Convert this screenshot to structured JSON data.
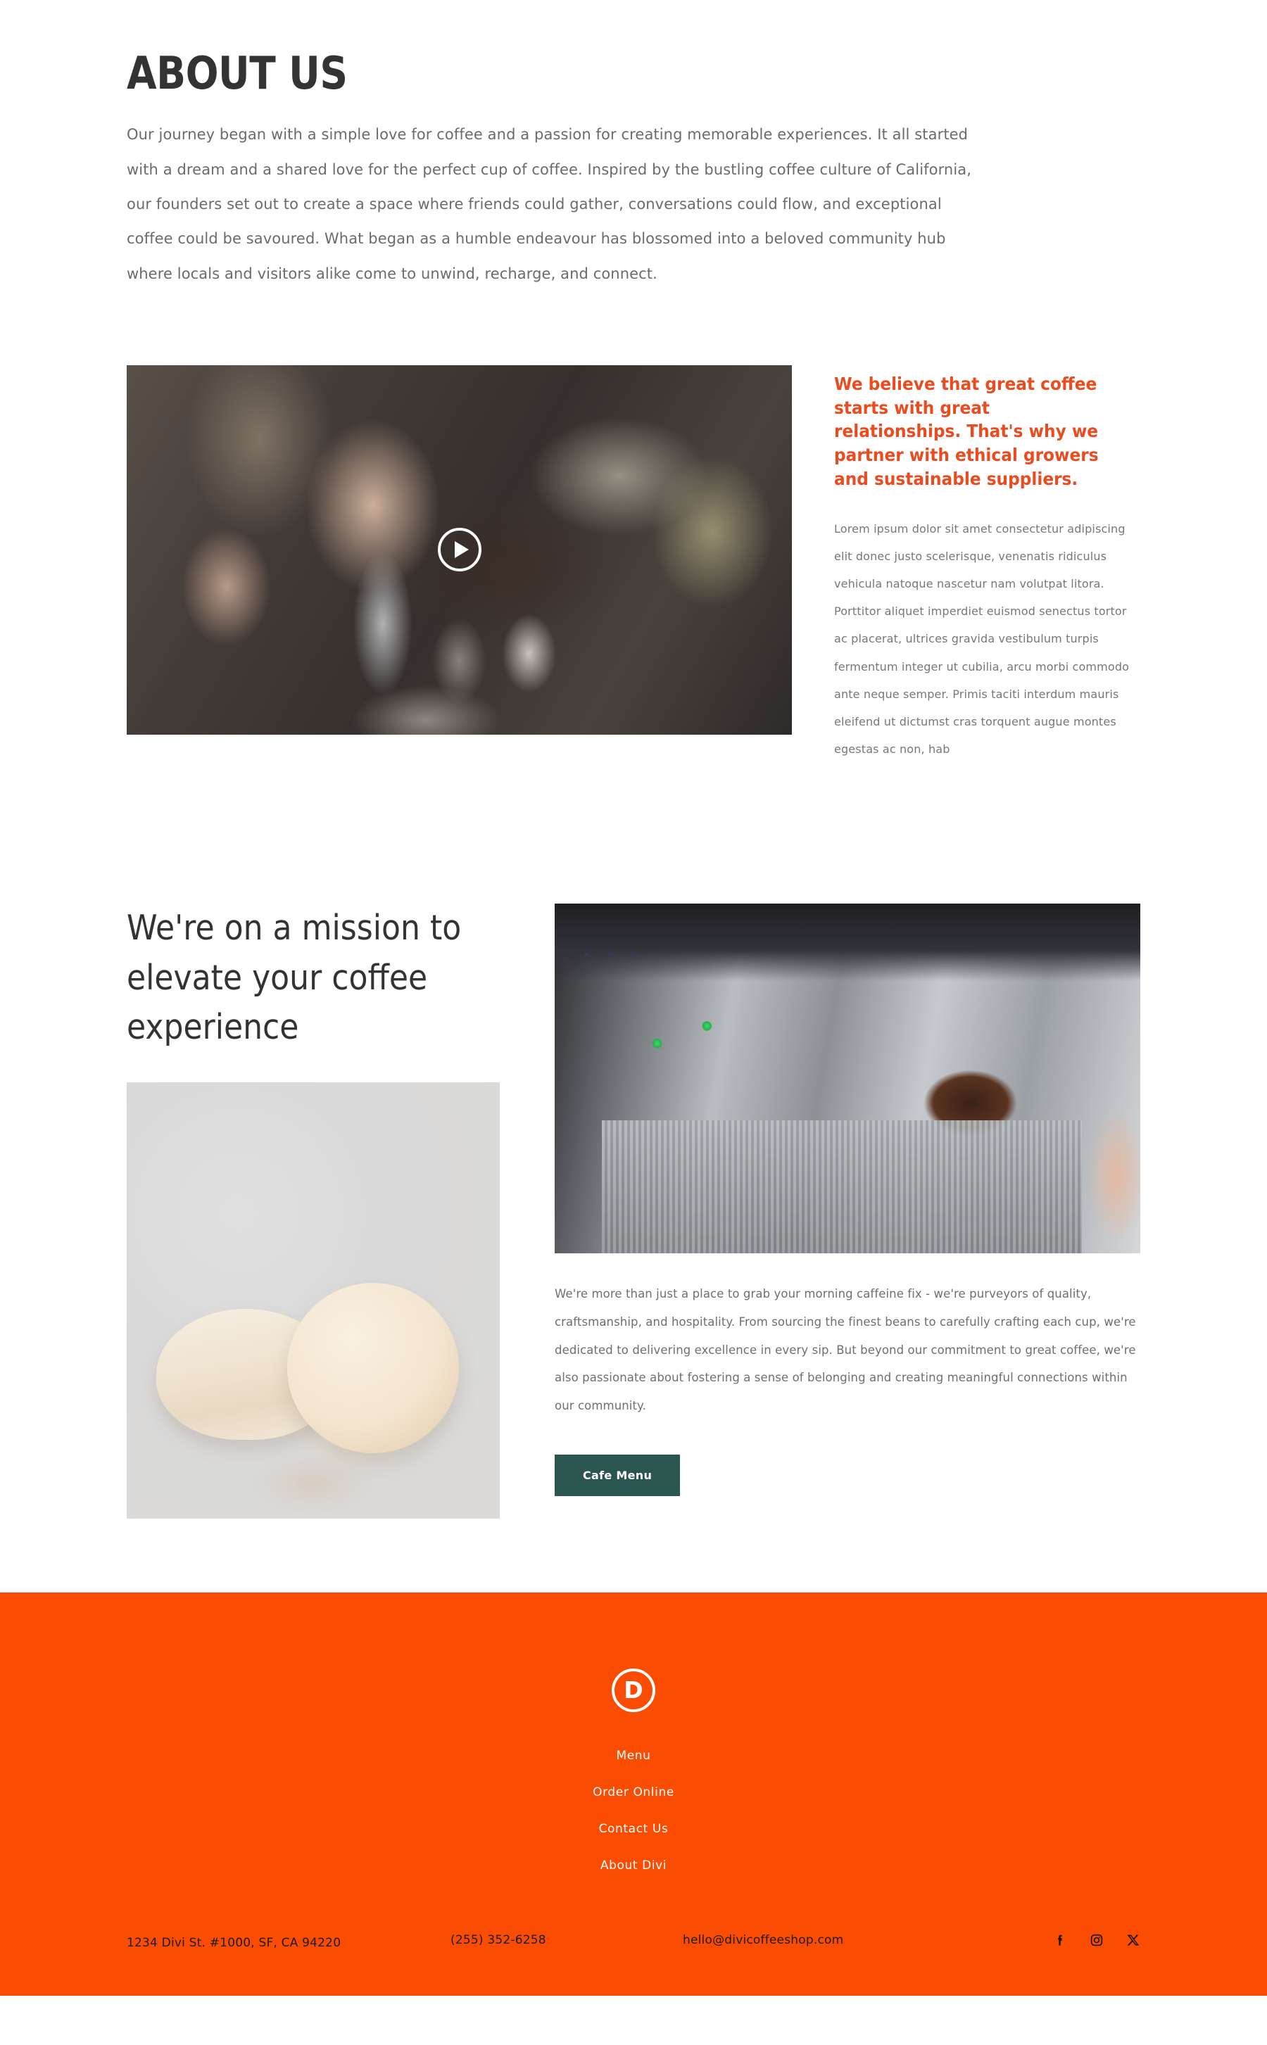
{
  "about": {
    "title": "ABOUT US",
    "paragraph": "Our journey began with a simple love for coffee and a passion for creating memorable experiences. It all started with a dream and a shared love for the perfect cup of coffee. Inspired by the bustling coffee culture of California, our founders set out to create a space where friends could gather, conversations could flow, and exceptional coffee could be savoured. What began as a humble endeavour has blossomed into a beloved community hub where locals and visitors alike come to unwind, recharge, and connect."
  },
  "video": {
    "alt": "barista tamping espresso grounds into a portafilter",
    "play_label": "Play video"
  },
  "statement": {
    "heading": "We believe that great coffee starts with great relationships. That's why we partner with ethical growers and sustainable suppliers.",
    "body": "Lorem ipsum dolor sit amet consectetur adipiscing elit donec justo scelerisque, venenatis ridiculus vehicula natoque nascetur nam volutpat litora. Porttitor aliquet imperdiet euismod senectus tortor ac placerat, ultrices gravida vestibulum turpis fermentum integer ut cubilia, arcu morbi commodo ante neque semper. Primis taciti interdum mauris eleifend ut dictumst cras torquent augue montes egestas ac non, hab"
  },
  "mission": {
    "heading": "We're on a mission to elevate your coffee experience",
    "macaron_alt": "two pale macarons dusted with cocoa on a light surface",
    "machine_alt": "espresso machine pulling a shot into a portafilter",
    "paragraph": "We're more than just a place to grab your morning caffeine fix - we're purveyors of quality, craftsmanship, and hospitality. From sourcing the finest beans to carefully crafting each cup, we're dedicated to delivering excellence in every sip. But beyond our commitment to great coffee, we're also passionate about fostering a sense of belonging and creating meaningful connections within our community.",
    "button_label": "Cafe Menu"
  },
  "footer": {
    "logo_letter": "D",
    "nav": [
      {
        "label": "Menu"
      },
      {
        "label": "Order Online"
      },
      {
        "label": "Contact Us"
      },
      {
        "label": "About Divi"
      }
    ],
    "address": "1234 Divi St. #1000, SF, CA 94220",
    "phone": "(255) 352-6258",
    "email": "hello@divicoffeeshop.com",
    "social": [
      {
        "name": "facebook"
      },
      {
        "name": "instagram"
      },
      {
        "name": "x-twitter"
      }
    ]
  },
  "colors": {
    "brand_orange": "#fa4d03",
    "statement_orange": "#ea4b1f",
    "button_teal": "#2b5650",
    "heading_dark": "#333333",
    "body_gray": "#6b6b6b"
  }
}
